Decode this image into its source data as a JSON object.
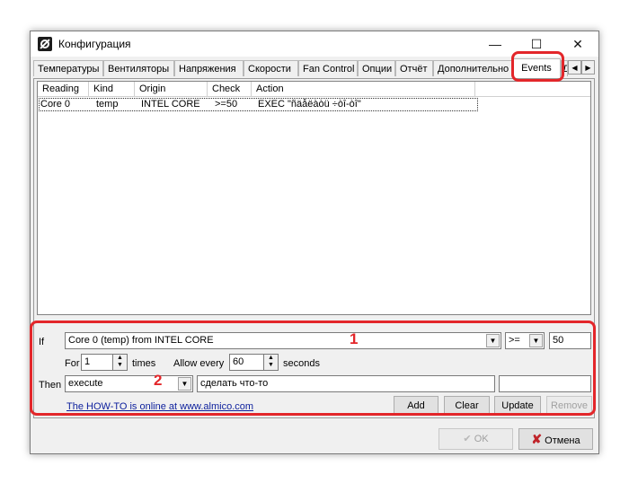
{
  "window": {
    "title": "Конфигурация",
    "controls": {
      "minimize": "—",
      "maximize": "☐",
      "close": "✕"
    }
  },
  "tabs": [
    {
      "label": "Температуры"
    },
    {
      "label": "Вентиляторы"
    },
    {
      "label": "Напряжения"
    },
    {
      "label": "Скорости"
    },
    {
      "label": "Fan Control"
    },
    {
      "label": "Опции"
    },
    {
      "label": "Отчёт"
    },
    {
      "label": "Дополнительно"
    },
    {
      "label": "Events",
      "active": true
    },
    {
      "label": "Д"
    }
  ],
  "tab_scroll": {
    "left": "◀",
    "right": "▶"
  },
  "events_table": {
    "columns": [
      "Reading",
      "Kind",
      "Origin",
      "Check",
      "Action"
    ],
    "rows": [
      {
        "reading": "Core 0",
        "kind": "temp",
        "origin": "INTEL CORE",
        "check": ">=50",
        "action": "EXEC \"ñäåëàòü ÷òî-òî\""
      }
    ]
  },
  "rule": {
    "if_label": "If",
    "sensor": "Core 0 (temp) from INTEL CORE",
    "operator": ">=",
    "threshold": "50",
    "for_label": "For",
    "for_value": "1",
    "times_label": "times",
    "allow_label": "Allow every",
    "allow_value": "60",
    "seconds_label": "seconds",
    "then_label": "Then",
    "action_type": "execute",
    "action_value": "сделать что-то",
    "action_extra": ""
  },
  "rule_buttons": {
    "add": "Add",
    "clear": "Clear",
    "update": "Update",
    "remove": "Remove"
  },
  "howto_link": "The HOW-TO is online at www.almico.com",
  "dialog_buttons": {
    "ok": "OK",
    "cancel": "Отмена"
  },
  "annotations": {
    "marker_1": "1",
    "marker_2": "2"
  },
  "colors": {
    "annotation": "#e3262a",
    "link": "#0b1e9c"
  }
}
